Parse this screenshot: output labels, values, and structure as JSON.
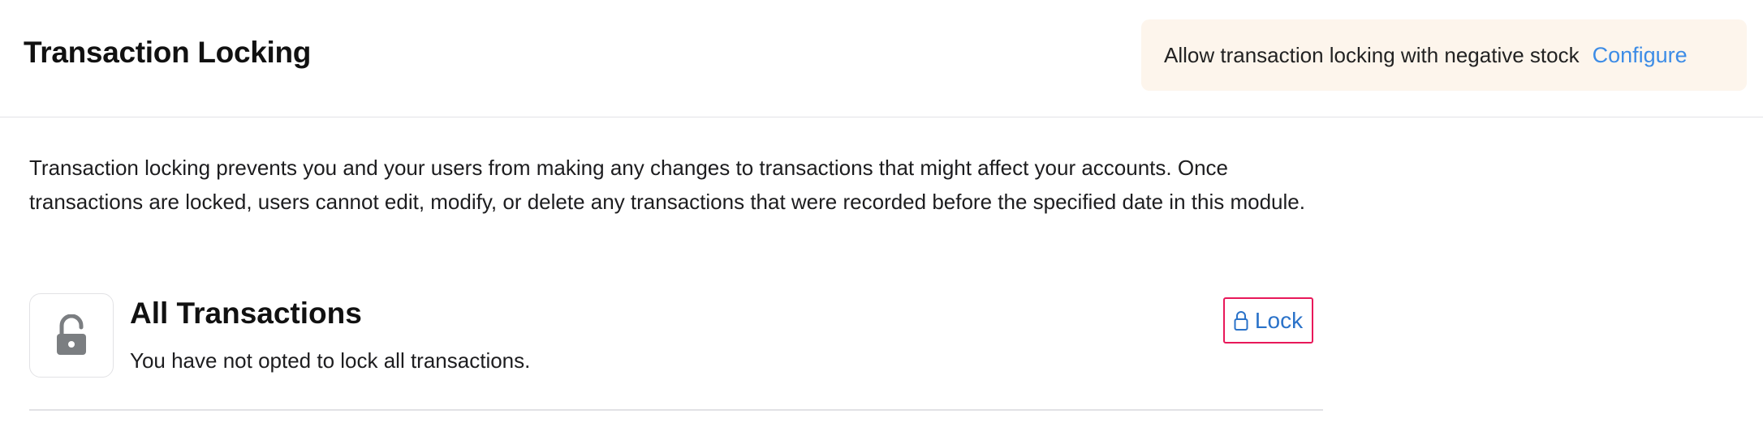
{
  "header": {
    "title": "Transaction Locking",
    "notice": {
      "text": "Allow transaction locking with negative stock",
      "link_label": "Configure"
    }
  },
  "description": "Transaction locking prevents you and your users from making any changes to transactions that might affect your accounts. Once transactions are locked, users cannot edit, modify, or delete any transactions that were recorded before the specified date in this module.",
  "lock_section": {
    "icon": "unlocked-padlock-icon",
    "title": "All Transactions",
    "subtitle": "You have not opted to lock all transactions.",
    "button": {
      "icon": "lock-outline-icon",
      "label": "Lock"
    }
  },
  "colors": {
    "accent_link": "#3d8ce6",
    "button_text": "#2a72c9",
    "button_focus_border": "#e8185a",
    "notice_bg": "#fdf5ec",
    "icon_gray": "#7b7e81"
  }
}
